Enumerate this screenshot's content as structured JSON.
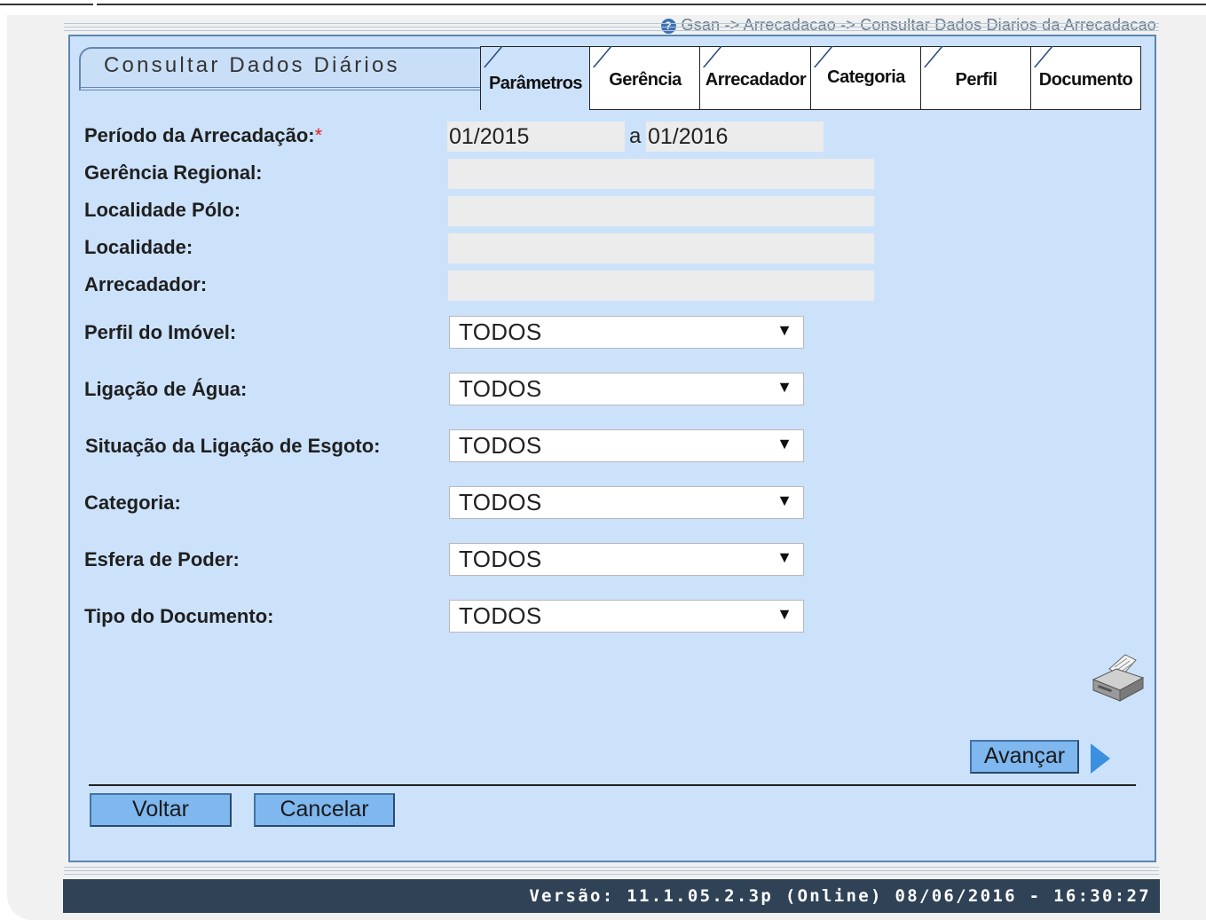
{
  "breadcrumb": {
    "text": "Gsan -> Arrecadacao -> Consultar Dados Diarios da Arrecadacao",
    "help_icon": "question-circle-icon"
  },
  "page": {
    "title": "Consultar Dados Diários"
  },
  "tabs": [
    {
      "label": "Parâmetros",
      "active": true
    },
    {
      "label": "Gerência",
      "active": false
    },
    {
      "label": "Arrecadador",
      "active": false
    },
    {
      "label": "Categoria",
      "active": false
    },
    {
      "label": "Perfil",
      "active": false
    },
    {
      "label": "Documento",
      "active": false
    }
  ],
  "form": {
    "periodo": {
      "label": "Período da Arrecadação:",
      "required_mark": "*",
      "from": "01/2015",
      "separator": "a",
      "to": "01/2016"
    },
    "gerencia_regional": {
      "label": "Gerência Regional:",
      "value": ""
    },
    "localidade_polo": {
      "label": "Localidade Pólo:",
      "value": ""
    },
    "localidade": {
      "label": "Localidade:",
      "value": ""
    },
    "arrecadador": {
      "label": "Arrecadador:",
      "value": ""
    },
    "perfil_imovel": {
      "label": "Perfil do Imóvel:",
      "selected": "TODOS"
    },
    "ligacao_agua": {
      "label": "Ligação de Água:",
      "selected": "TODOS"
    },
    "situacao_esgoto": {
      "label": "Situação da Ligação de Esgoto:",
      "selected": "TODOS"
    },
    "categoria": {
      "label": "Categoria:",
      "selected": "TODOS"
    },
    "esfera_poder": {
      "label": "Esfera de Poder:",
      "selected": "TODOS"
    },
    "tipo_documento": {
      "label": "Tipo do Documento:",
      "selected": "TODOS"
    }
  },
  "actions": {
    "printer_icon": "printer-icon",
    "avancar": "Avançar",
    "voltar": "Voltar",
    "cancelar": "Cancelar"
  },
  "footer": {
    "version": "Versão: 11.1.05.2.3p (Online) 08/06/2016 - 16:30:27"
  },
  "colors": {
    "panel_bg": "#cce2fb",
    "button_bg": "#7fb7ef",
    "footer_bg": "#2f4256",
    "required": "#e02020"
  }
}
